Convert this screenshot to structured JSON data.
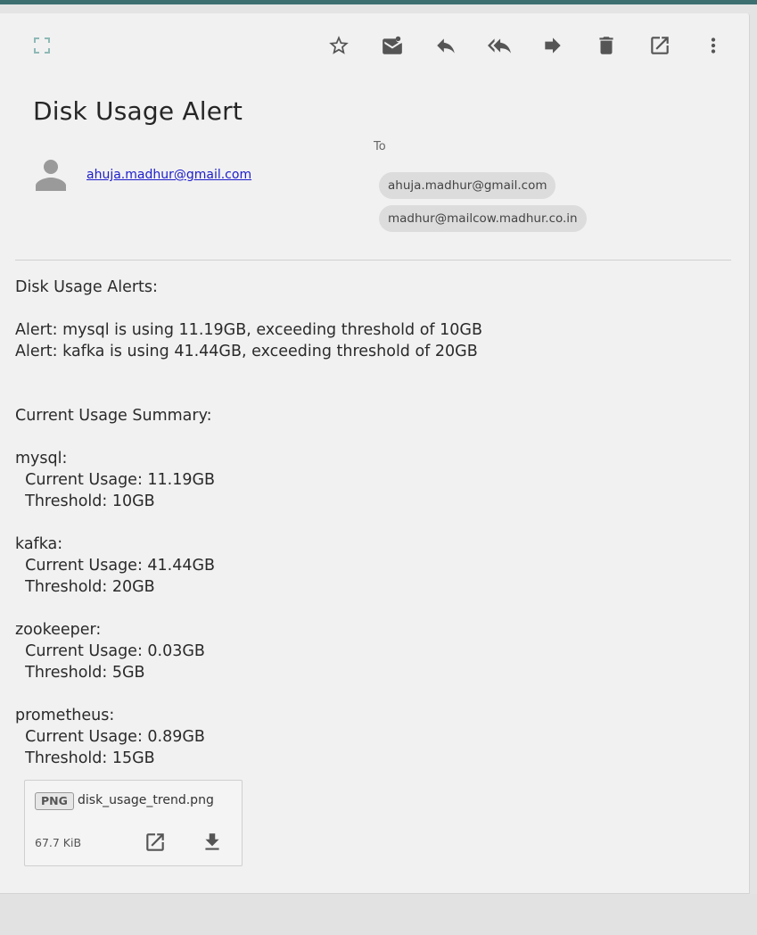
{
  "toolbar": {
    "fullscreen_icon": "fullscreen-icon",
    "buttons": [
      "star",
      "mark-unread",
      "reply",
      "reply-all",
      "forward",
      "delete",
      "open-in-new",
      "more"
    ]
  },
  "message": {
    "subject": "Disk Usage Alert",
    "sender_email": "ahuja.madhur@gmail.com",
    "to_label": "To",
    "recipients": [
      "ahuja.madhur@gmail.com",
      "madhur@mailcow.madhur.co.in"
    ],
    "body": "Disk Usage Alerts:\n\nAlert: mysql is using 11.19GB, exceeding threshold of 10GB\nAlert: kafka is using 41.44GB, exceeding threshold of 20GB\n\n\nCurrent Usage Summary:\n\nmysql:\n  Current Usage: 11.19GB\n  Threshold: 10GB\n\nkafka:\n  Current Usage: 41.44GB\n  Threshold: 20GB\n\nzookeeper:\n  Current Usage: 0.03GB\n  Threshold: 5GB\n\nprometheus:\n  Current Usage: 0.89GB\n  Threshold: 15GB"
  },
  "attachment": {
    "type": "PNG",
    "name": "disk_usage_trend.png",
    "size": "67.7 KiB"
  },
  "colors": {
    "accent": "#3d6f70",
    "link": "#1d1dcc",
    "chip_bg": "#dcdcdc"
  }
}
